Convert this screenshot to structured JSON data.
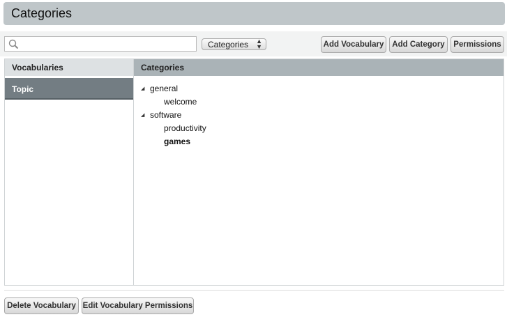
{
  "header": {
    "title": "Categories"
  },
  "toolbar": {
    "search_value": "",
    "search_placeholder": "",
    "select_value": "Categories",
    "add_vocabulary_label": "Add Vocabulary",
    "add_category_label": "Add Category",
    "permissions_label": "Permissions"
  },
  "vocabularies": {
    "header": "Vocabularies",
    "items": [
      {
        "label": "Topic",
        "selected": true
      }
    ]
  },
  "categories": {
    "header": "Categories",
    "tree": [
      {
        "label": "general",
        "expanded": true,
        "children": [
          {
            "label": "welcome"
          }
        ]
      },
      {
        "label": "software",
        "expanded": true,
        "children": [
          {
            "label": "productivity"
          },
          {
            "label": "games",
            "selected": true
          }
        ]
      }
    ]
  },
  "footer": {
    "delete_vocabulary_label": "Delete Vocabulary",
    "edit_vocabulary_permissions_label": "Edit Vocabulary Permissions"
  },
  "colors": {
    "title_bar": "#bfc6c9",
    "selected_row": "#737d83",
    "categories_header": "#aab3b7"
  }
}
